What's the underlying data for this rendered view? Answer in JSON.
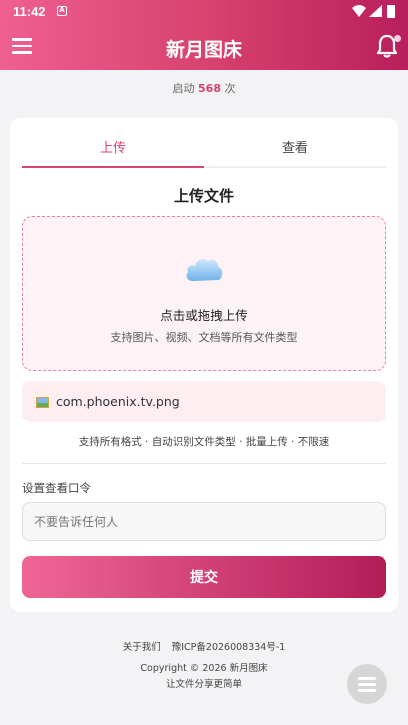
{
  "status_bar": {
    "time": "11:42",
    "notification_icon": "A"
  },
  "header": {
    "title": "新月图床",
    "menu_icon": "hamburger-icon",
    "bell_icon": "bell-icon"
  },
  "launch": {
    "prefix": "启动",
    "count": "568",
    "suffix": "次"
  },
  "tabs": [
    {
      "label": "上传",
      "active": true
    },
    {
      "label": "查看",
      "active": false
    }
  ],
  "upload": {
    "title": "上传文件",
    "drop_main": "点击或拖拽上传",
    "drop_sub": "支持图片、视频、文档等所有文件类型",
    "file_name": "com.phoenix.tv.png",
    "features": "支持所有格式 · 自动识别文件类型 · 批量上传 · 不限速"
  },
  "password": {
    "label": "设置查看口令",
    "placeholder": "不要告诉任何人"
  },
  "submit_label": "提交",
  "footer": {
    "about": "关于我们",
    "icp": "豫ICP备2026008334号-1",
    "copyright": "Copyright © 2026 新月图床",
    "slogan": "让文件分享更简单"
  },
  "colors": {
    "accent": "#d8436f",
    "gradient_start": "#ef5f91",
    "gradient_end": "#b91f5b"
  }
}
